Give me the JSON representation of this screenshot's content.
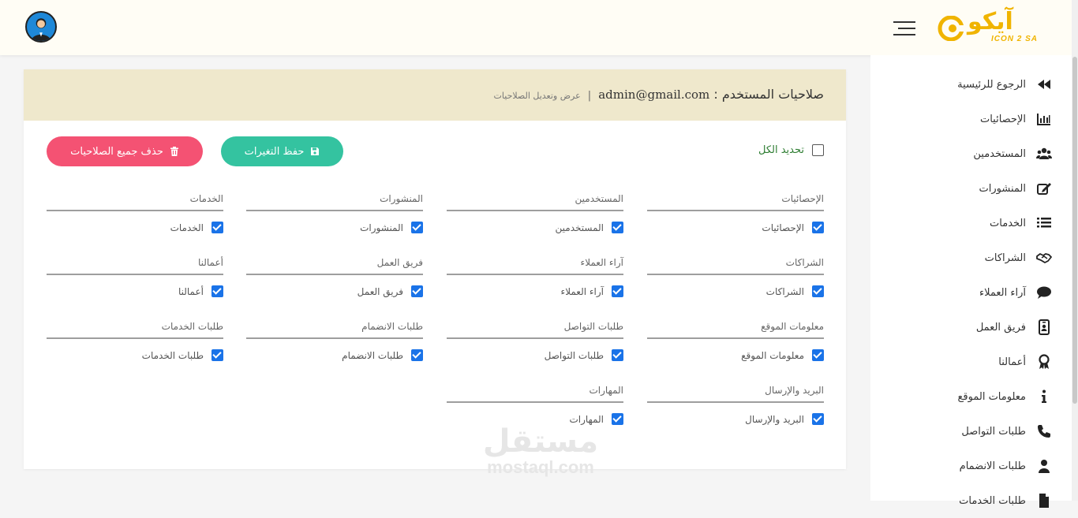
{
  "header": {
    "brand_ar": "آيكو",
    "brand_en": "ICON 2 SA"
  },
  "sidebar": {
    "items": [
      {
        "label": "الرجوع للرئيسية",
        "icon": "backward-icon"
      },
      {
        "label": "الإحصائيات",
        "icon": "bar-chart-icon"
      },
      {
        "label": "المستخدمين",
        "icon": "users-icon"
      },
      {
        "label": "المنشورات",
        "icon": "edit-icon"
      },
      {
        "label": "الخدمات",
        "icon": "list-icon"
      },
      {
        "label": "الشراكات",
        "icon": "handshake-icon"
      },
      {
        "label": "آراء العملاء",
        "icon": "comment-icon"
      },
      {
        "label": "فريق العمل",
        "icon": "id-badge-icon"
      },
      {
        "label": "أعمالنا",
        "icon": "award-icon"
      },
      {
        "label": "معلومات الموقع",
        "icon": "info-icon"
      },
      {
        "label": "طلبات التواصل",
        "icon": "phone-icon"
      },
      {
        "label": "طلبات الانضمام",
        "icon": "user-icon"
      },
      {
        "label": "طلبات الخدمات",
        "icon": "file-icon"
      }
    ]
  },
  "card": {
    "title": "صلاحيات المستخدم :",
    "email": "admin@gmail.com",
    "separator": "|",
    "subtitle": "عرض وتعديل الصلاحيات",
    "select_all_label": "تحديد الكل",
    "select_all_checked": false,
    "save_label": "حفظ التغيرات",
    "delete_label": "حذف جميع الصلاحيات"
  },
  "permissions": [
    {
      "group": "الإحصائيات",
      "label": "الإحصائيات",
      "checked": true
    },
    {
      "group": "المستخدمين",
      "label": "المستخدمين",
      "checked": true
    },
    {
      "group": "المنشورات",
      "label": "المنشورات",
      "checked": true
    },
    {
      "group": "الخدمات",
      "label": "الخدمات",
      "checked": true
    },
    {
      "group": "الشراكات",
      "label": "الشراكات",
      "checked": true
    },
    {
      "group": "آراء العملاء",
      "label": "آراء العملاء",
      "checked": true
    },
    {
      "group": "فريق العمل",
      "label": "فريق العمل",
      "checked": true
    },
    {
      "group": "أعمالنا",
      "label": "أعمالنا",
      "checked": true
    },
    {
      "group": "معلومات الموقع",
      "label": "معلومات الموقع",
      "checked": true
    },
    {
      "group": "طلبات التواصل",
      "label": "طلبات التواصل",
      "checked": true
    },
    {
      "group": "طلبات الانضمام",
      "label": "طلبات الانضمام",
      "checked": true
    },
    {
      "group": "طلبات الخدمات",
      "label": "طلبات الخدمات",
      "checked": true
    },
    {
      "group": "البريد والإرسال",
      "label": "البريد والإرسال",
      "checked": true
    },
    {
      "group": "المهارات",
      "label": "المهارات",
      "checked": true
    }
  ],
  "watermark": {
    "ar": "مستقل",
    "en": "mostaql.com"
  },
  "colors": {
    "save": "#34c3a0",
    "delete": "#f45273",
    "header_band": "#efe8cc",
    "brand": "#f0b400",
    "checkbox": "#1a73e8"
  }
}
